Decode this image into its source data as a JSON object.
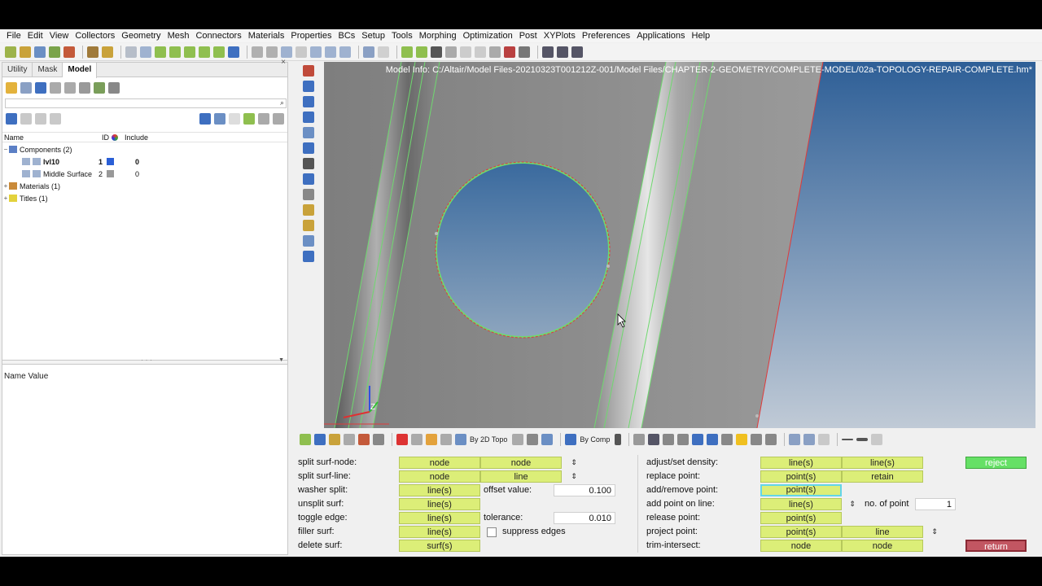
{
  "menu": [
    "File",
    "Edit",
    "View",
    "Collectors",
    "Geometry",
    "Mesh",
    "Connectors",
    "Materials",
    "Properties",
    "BCs",
    "Setup",
    "Tools",
    "Morphing",
    "Optimization",
    "Post",
    "XYPlots",
    "Preferences",
    "Applications",
    "Help"
  ],
  "left_panel": {
    "tabs": [
      "Utility",
      "Mask",
      "Model"
    ],
    "active_tab": "Model",
    "close": "×",
    "columns": {
      "name": "Name",
      "id": "ID",
      "include": "Include"
    },
    "tree": [
      {
        "label": "Components (2)",
        "exp": "−"
      },
      {
        "label": "lvl10",
        "id": "1",
        "include": "0",
        "color": "#2a5fd6"
      },
      {
        "label": "Middle Surface",
        "id": "2",
        "include": "0",
        "color": "#999999"
      },
      {
        "label": "Materials (1)",
        "exp": "+"
      },
      {
        "label": "Titles (1)",
        "exp": "+"
      }
    ],
    "properties_header": "Name Value"
  },
  "viewport": {
    "model_info": "Model Info: C:/Altair/Model Files-20210323T001212Z-001/Model Files/CHAPTER-2-GEOMETRY/COMPLETE-MODEL/02a-TOPOLOGY-REPAIR-COMPLETE.hm*",
    "axes": {
      "x": "X",
      "y": "Y",
      "z": "Z"
    }
  },
  "bottom_toolbar": {
    "topo_label": "By 2D Topo",
    "comp_label": "By Comp"
  },
  "panel": {
    "left_rows": [
      {
        "label": "split surf-node:",
        "b1": "node",
        "b2": "node"
      },
      {
        "label": "split surf-line:",
        "b1": "node",
        "b2": "line"
      },
      {
        "label": "washer split:",
        "b1": "line(s)",
        "extra_label": "offset value:",
        "extra_value": "0.100"
      },
      {
        "label": "unsplit surf:",
        "b1": "line(s)"
      },
      {
        "label": "toggle edge:",
        "b1": "line(s)",
        "extra_label": "tolerance:",
        "extra_value": "0.010"
      },
      {
        "label": "filler surf:",
        "b1": "line(s)",
        "check_label": "suppress edges"
      },
      {
        "label": "delete surf:",
        "b1": "surf(s)"
      }
    ],
    "right_rows": [
      {
        "label": "adjust/set density:",
        "b1": "line(s)",
        "b2": "line(s)"
      },
      {
        "label": "replace point:",
        "b1": "point(s)",
        "b2": "retain"
      },
      {
        "label": "add/remove point:",
        "b1": "point(s)"
      },
      {
        "label": "add point on line:",
        "b1": "line(s)",
        "extra_label": "no. of point",
        "extra_value": "1"
      },
      {
        "label": "release point:",
        "b1": "point(s)"
      },
      {
        "label": "project point:",
        "b1": "point(s)",
        "b2": "line"
      },
      {
        "label": "trim-intersect:",
        "b1": "node",
        "b2": "node"
      }
    ],
    "reject": "reject",
    "return": "return",
    "drop": "⇕"
  }
}
